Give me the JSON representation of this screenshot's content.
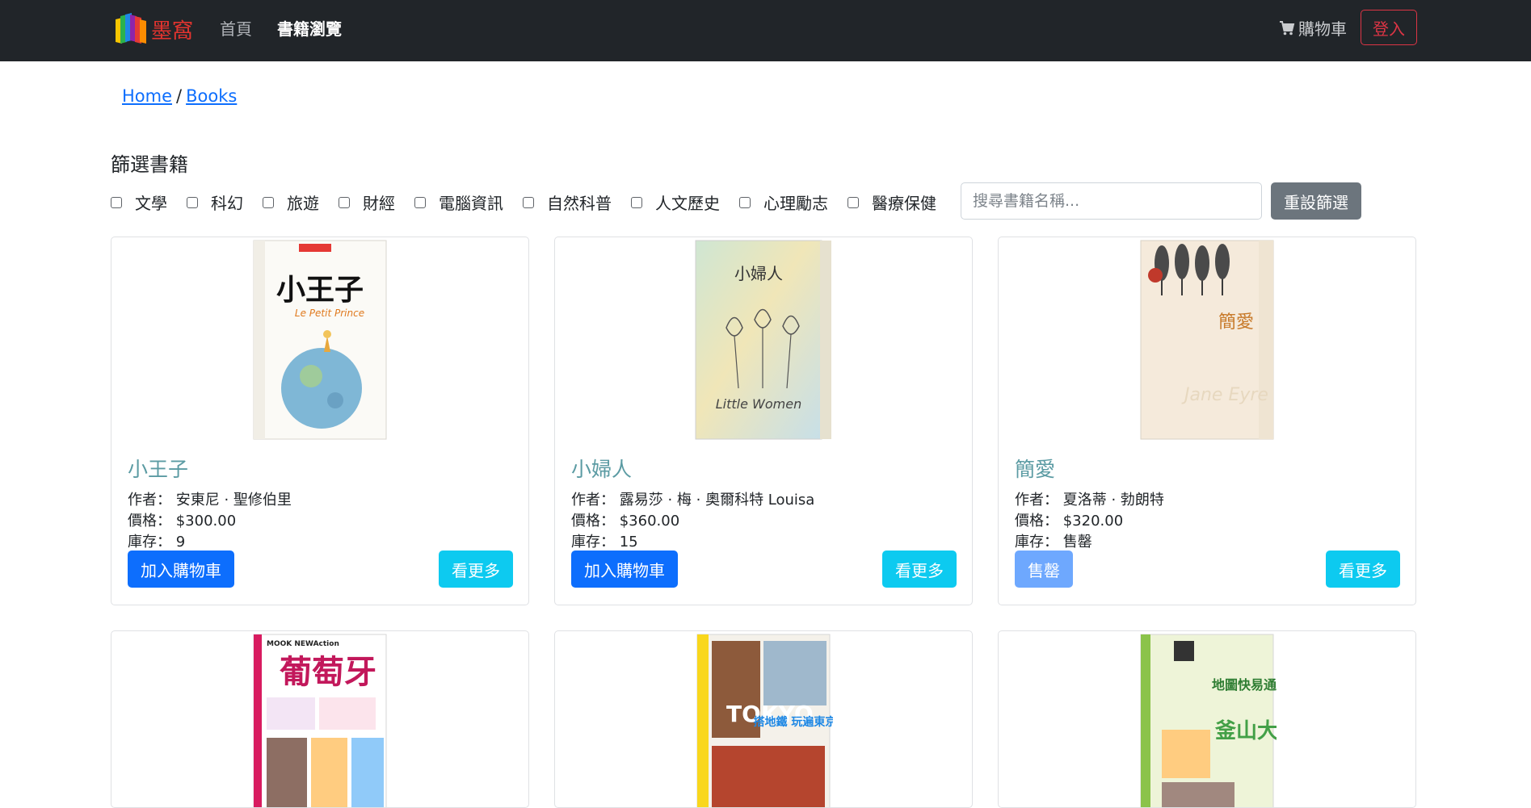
{
  "navbar": {
    "brand": "墨窩",
    "links": [
      "首頁",
      "書籍瀏覽"
    ],
    "cart_label": "購物車",
    "login_label": "登入"
  },
  "breadcrumb": {
    "home": "Home",
    "separator": "/",
    "books": "Books"
  },
  "filters": {
    "title": "篩選書籍",
    "categories": [
      "文學",
      "科幻",
      "旅遊",
      "財經",
      "電腦資訊",
      "自然科普",
      "人文歷史",
      "心理勵志",
      "醫療保健"
    ],
    "search_placeholder": "搜尋書籍名稱...",
    "reset_label": "重設篩選"
  },
  "labels": {
    "author": "作者：",
    "price": "價格：",
    "stock": "庫存：",
    "add_to_cart": "加入購物車",
    "sold_out": "售罄",
    "more": "看更多"
  },
  "books": [
    {
      "title": "小王子",
      "author": "安東尼 · 聖修伯里",
      "price": "$300.00",
      "stock": "9",
      "sold_out": false
    },
    {
      "title": "小婦人",
      "author": "露易莎 · 梅 · 奧爾科特 Louisa",
      "price": "$360.00",
      "stock": "15",
      "sold_out": false
    },
    {
      "title": "簡愛",
      "author": "夏洛蒂 · 勃朗特",
      "price": "$320.00",
      "stock": "售罄",
      "sold_out": true
    }
  ],
  "covers": {
    "book1_title": "小王子",
    "book1_subtitle": "Le Petit Prince",
    "book2_title": "小婦人",
    "book2_subtitle": "Little Women",
    "book3_title": "簡愛",
    "book3_subtitle": "Jane Eyre",
    "book4_brand": "MOOK NEWAction",
    "book4_title": "葡萄牙",
    "book5_title": "TOKYO",
    "book5_subtitle": "搭地鐵 玩遍東京",
    "book6_title": "地圖快易通",
    "book6_subtitle": "釜山大邱"
  },
  "colors": {
    "navbar_bg": "#212529",
    "primary": "#0d6efd",
    "info": "#0dcaf0",
    "secondary": "#6c757d",
    "danger": "#dc3545",
    "title_teal": "#5b9ba3"
  }
}
